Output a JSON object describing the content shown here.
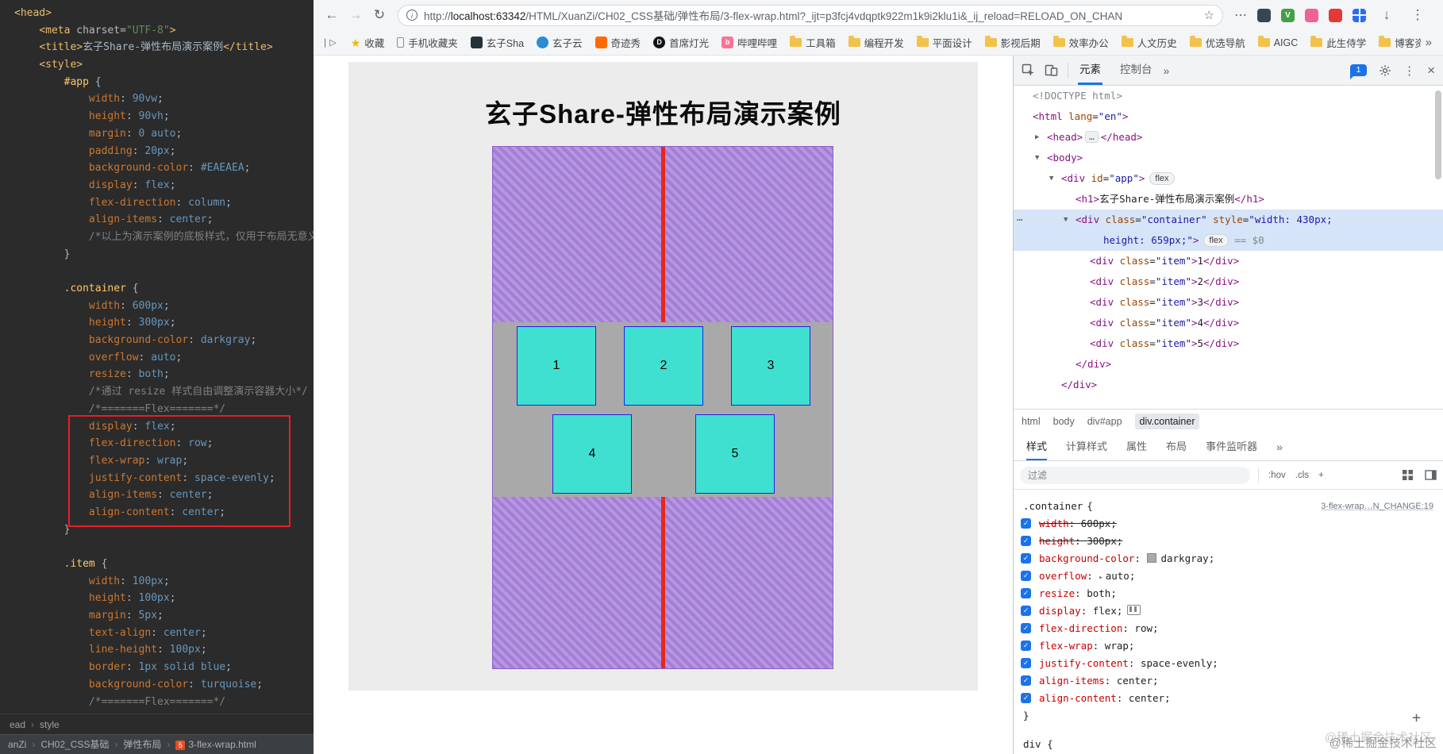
{
  "page": {
    "title": "玄子Share-弹性布局演示案例",
    "items": [
      "1",
      "2",
      "3",
      "4",
      "5"
    ]
  },
  "ide": {
    "breadcrumb_left": "ead",
    "breadcrumb_right": "style",
    "status_path": [
      "anZi",
      "CH02_CSS基础",
      "弹性布局",
      "3-flex-wrap.html"
    ],
    "code_lines": [
      {
        "t": [
          [
            "tag",
            "<head>"
          ]
        ]
      },
      {
        "t": [
          [
            "pln",
            "    "
          ],
          [
            "tag",
            "<meta "
          ],
          [
            "atn",
            "charset="
          ],
          [
            "str",
            "\"UTF-8\""
          ],
          [
            "tag",
            ">"
          ]
        ]
      },
      {
        "t": [
          [
            "pln",
            "    "
          ],
          [
            "tag",
            "<title>"
          ],
          [
            "pln",
            "玄子Share-弹性布局演示案例"
          ],
          [
            "tag",
            "</title>"
          ]
        ]
      },
      {
        "t": [
          [
            "pln",
            "    "
          ],
          [
            "tag",
            "<style>"
          ]
        ]
      },
      {
        "s": "#app"
      },
      {
        "d": [
          "width",
          "90vw"
        ]
      },
      {
        "d": [
          "height",
          "90vh"
        ]
      },
      {
        "d": [
          "margin",
          "0 auto"
        ]
      },
      {
        "d": [
          "padding",
          "20px"
        ]
      },
      {
        "d": [
          "background-color",
          "#EAEAEA"
        ]
      },
      {
        "d": [
          "display",
          "flex"
        ]
      },
      {
        "d": [
          "flex-direction",
          "column"
        ]
      },
      {
        "d": [
          "align-items",
          "center"
        ]
      },
      {
        "c": "/*以上为演示案例的底板样式，仅用于布局无意义*/"
      },
      {
        "x": "}"
      },
      {},
      {
        "s": ".container"
      },
      {
        "d": [
          "width",
          "600px"
        ]
      },
      {
        "d": [
          "height",
          "300px"
        ]
      },
      {
        "d": [
          "background-color",
          "darkgray"
        ]
      },
      {
        "d": [
          "overflow",
          "auto"
        ]
      },
      {
        "d": [
          "resize",
          "both"
        ]
      },
      {
        "c": "/*通过 resize 样式自由调整演示容器大小*/"
      },
      {
        "c": "/*=======Flex=======*/"
      },
      {
        "d": [
          "display",
          "flex"
        ]
      },
      {
        "d": [
          "flex-direction",
          "row"
        ]
      },
      {
        "d": [
          "flex-wrap",
          "wrap"
        ]
      },
      {
        "d": [
          "justify-content",
          "space-evenly"
        ]
      },
      {
        "d": [
          "align-items",
          "center"
        ]
      },
      {
        "d": [
          "align-content",
          "center"
        ]
      },
      {
        "x": "}"
      },
      {},
      {
        "s": ".item"
      },
      {
        "d": [
          "width",
          "100px"
        ]
      },
      {
        "d": [
          "height",
          "100px"
        ]
      },
      {
        "d": [
          "margin",
          "5px"
        ]
      },
      {
        "d": [
          "text-align",
          "center"
        ]
      },
      {
        "d": [
          "line-height",
          "100px"
        ]
      },
      {
        "d": [
          "border",
          "1px solid blue"
        ]
      },
      {
        "d": [
          "background-color",
          "turquoise"
        ]
      },
      {
        "c": "/*=======Flex=======*/"
      }
    ]
  },
  "browser": {
    "url_scheme": "http://",
    "url_host": "localhost:63342",
    "url_path": "/HTML/XuanZi/CH02_CSS基础/弹性布局/3-flex-wrap.html?_ijt=p3fcj4vdqptk922m1k9i2klu1i&_ij_reload=RELOAD_ON_CHAN",
    "bookmarks_overflow": "»",
    "bookmarks": [
      {
        "label": "收藏",
        "icon": "star"
      },
      {
        "label": "手机收藏夹",
        "icon": "phone"
      },
      {
        "label": "玄子Sha",
        "icon": "site-dark"
      },
      {
        "label": "玄子云",
        "icon": "site-blue"
      },
      {
        "label": "奇迹秀",
        "icon": "site-orange"
      },
      {
        "label": "首席灯光",
        "icon": "site-black",
        "glyph": "D"
      },
      {
        "label": "哔哩哔哩",
        "icon": "site-pink",
        "glyph": "b"
      },
      {
        "label": "工具箱",
        "icon": "folder"
      },
      {
        "label": "编程开发",
        "icon": "folder"
      },
      {
        "label": "平面设计",
        "icon": "folder"
      },
      {
        "label": "影视后期",
        "icon": "folder"
      },
      {
        "label": "效率办公",
        "icon": "folder"
      },
      {
        "label": "人文历史",
        "icon": "folder"
      },
      {
        "label": "优选导航",
        "icon": "folder"
      },
      {
        "label": "AIGC",
        "icon": "folder"
      },
      {
        "label": "此生侍学",
        "icon": "folder"
      },
      {
        "label": "博客资料",
        "icon": "folder"
      }
    ]
  },
  "devtools": {
    "panel_tabs": [
      {
        "label": "元素",
        "selected": true
      },
      {
        "label": "控制台",
        "selected": false
      }
    ],
    "panel_tabs_more": "»",
    "issues_count": "1",
    "tree": [
      {
        "ind": 24,
        "tk": [
          [
            "gy",
            "<!DOCTYPE html>"
          ]
        ]
      },
      {
        "ind": 24,
        "tk": [
          [
            "tg",
            "<html "
          ],
          [
            "an",
            "lang"
          ],
          [
            "pu",
            "="
          ],
          [
            "av",
            "\"en\""
          ],
          [
            "tg",
            ">"
          ]
        ]
      },
      {
        "ind": 42,
        "arrow": "c",
        "tk": [
          [
            "tg",
            "<head>"
          ],
          [
            "el",
            "…"
          ],
          [
            "tg",
            "</head>"
          ]
        ]
      },
      {
        "ind": 42,
        "arrow": "o",
        "tk": [
          [
            "tg",
            "<body>"
          ]
        ]
      },
      {
        "ind": 60,
        "arrow": "o",
        "badge": "flex",
        "tk": [
          [
            "tg",
            "<div "
          ],
          [
            "an",
            "id"
          ],
          [
            "pu",
            "="
          ],
          [
            "av",
            "\"app\""
          ],
          [
            "tg",
            ">"
          ]
        ]
      },
      {
        "ind": 78,
        "tk": [
          [
            "tg",
            "<h1>"
          ],
          [
            "tx",
            "玄子Share-弹性布局演示案例"
          ],
          [
            "tg",
            "</h1>"
          ]
        ]
      },
      {
        "ind": 78,
        "arrow": "o",
        "sel": true,
        "dots": true,
        "tk": [
          [
            "tg",
            "<div "
          ],
          [
            "an",
            "class"
          ],
          [
            "pu",
            "="
          ],
          [
            "av",
            "\"container\""
          ],
          [
            "an",
            " style"
          ],
          [
            "pu",
            "="
          ],
          [
            "av",
            "\"width: 430px;"
          ]
        ]
      },
      {
        "ind": 113,
        "sel": true,
        "badge": "flex",
        "eq": " == $0",
        "tk": [
          [
            "av",
            "height: 659px;\""
          ],
          [
            "tg",
            ">"
          ]
        ]
      },
      {
        "ind": 96,
        "tk": [
          [
            "tg",
            "<div "
          ],
          [
            "an",
            "class"
          ],
          [
            "pu",
            "="
          ],
          [
            "av",
            "\"item\""
          ],
          [
            "tg",
            ">"
          ],
          [
            "tx",
            "1"
          ],
          [
            "tg",
            "</div>"
          ]
        ]
      },
      {
        "ind": 96,
        "tk": [
          [
            "tg",
            "<div "
          ],
          [
            "an",
            "class"
          ],
          [
            "pu",
            "="
          ],
          [
            "av",
            "\"item\""
          ],
          [
            "tg",
            ">"
          ],
          [
            "tx",
            "2"
          ],
          [
            "tg",
            "</div>"
          ]
        ]
      },
      {
        "ind": 96,
        "tk": [
          [
            "tg",
            "<div "
          ],
          [
            "an",
            "class"
          ],
          [
            "pu",
            "="
          ],
          [
            "av",
            "\"item\""
          ],
          [
            "tg",
            ">"
          ],
          [
            "tx",
            "3"
          ],
          [
            "tg",
            "</div>"
          ]
        ]
      },
      {
        "ind": 96,
        "tk": [
          [
            "tg",
            "<div "
          ],
          [
            "an",
            "class"
          ],
          [
            "pu",
            "="
          ],
          [
            "av",
            "\"item\""
          ],
          [
            "tg",
            ">"
          ],
          [
            "tx",
            "4"
          ],
          [
            "tg",
            "</div>"
          ]
        ]
      },
      {
        "ind": 96,
        "tk": [
          [
            "tg",
            "<div "
          ],
          [
            "an",
            "class"
          ],
          [
            "pu",
            "="
          ],
          [
            "av",
            "\"item\""
          ],
          [
            "tg",
            ">"
          ],
          [
            "tx",
            "5"
          ],
          [
            "tg",
            "</div>"
          ]
        ]
      },
      {
        "ind": 78,
        "tk": [
          [
            "tg",
            "</div>"
          ]
        ]
      },
      {
        "ind": 60,
        "tk": [
          [
            "tg",
            "</div>"
          ]
        ]
      }
    ],
    "breadcrumbs": [
      {
        "label": "html"
      },
      {
        "label": "body"
      },
      {
        "label": "div#app"
      },
      {
        "label": "div.container",
        "selected": true
      }
    ],
    "sidebar_tabs": [
      {
        "label": "样式",
        "selected": true
      },
      {
        "label": "计算样式"
      },
      {
        "label": "属性"
      },
      {
        "label": "布局"
      },
      {
        "label": "事件监听器"
      }
    ],
    "sidebar_tabs_more": "»",
    "filter_placeholder": "过滤",
    "toggles": [
      ":hov",
      ".cls",
      "+"
    ],
    "rule": {
      "selector": ".container",
      "open_brace": "{",
      "close_brace": "}",
      "source_link": "3-flex-wrap…N_CHANGE:19",
      "props": [
        {
          "n": "width",
          "v": "600px",
          "strike": true
        },
        {
          "n": "height",
          "v": "300px",
          "strike": true
        },
        {
          "n": "background-color",
          "v": "darkgray",
          "swatch": "#a9a9a9"
        },
        {
          "n": "overflow",
          "v": "auto",
          "arrow": true
        },
        {
          "n": "resize",
          "v": "both"
        },
        {
          "n": "display",
          "v": "flex",
          "flexbtn": true
        },
        {
          "n": "flex-direction",
          "v": "row"
        },
        {
          "n": "flex-wrap",
          "v": "wrap"
        },
        {
          "n": "justify-content",
          "v": "space-evenly"
        },
        {
          "n": "align-items",
          "v": "center"
        },
        {
          "n": "align-content",
          "v": "center"
        }
      ]
    },
    "next_rule_selector": "div {",
    "new_rule_plus": "+",
    "watermark": "@稀土掘金技术社区"
  }
}
